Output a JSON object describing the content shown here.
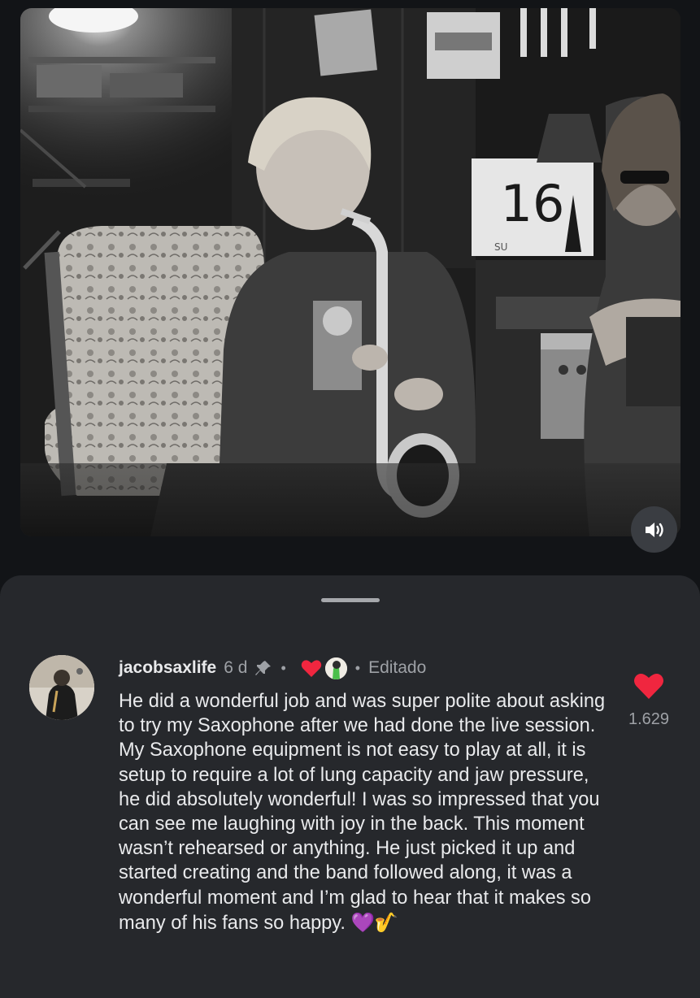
{
  "video": {
    "calendar_day": "16",
    "calendar_weekday": "SU"
  },
  "comment": {
    "username": "jacobsaxlife",
    "time_ago": "6 d",
    "separator": "•",
    "edited_label": "Editado",
    "text": "He did a wonderful job and was super polite about asking to try my Saxophone after we had done the live session. My Saxophone equipment is not easy to play at all, it is setup to require a lot of lung capacity and jaw pressure, he did absolutely wonderful! I was so impressed that you can see me laughing with joy in the back. This moment wasn’t rehearsed or anything. He just picked it up and started creating and the band followed along, it was a wonderful moment and I’m glad to hear that it makes so many of his fans so happy.",
    "emoji_heart": "💜",
    "emoji_sax": "🎷",
    "like_count": "1.629"
  },
  "colors": {
    "background": "#121417",
    "sheet": "#26282c",
    "like_red": "#f0263f",
    "text_primary": "#e9eaec",
    "text_secondary": "#9ea1a6"
  },
  "icons": {
    "mute": "speaker-icon",
    "pin": "pin-icon",
    "like": "heart-icon"
  }
}
